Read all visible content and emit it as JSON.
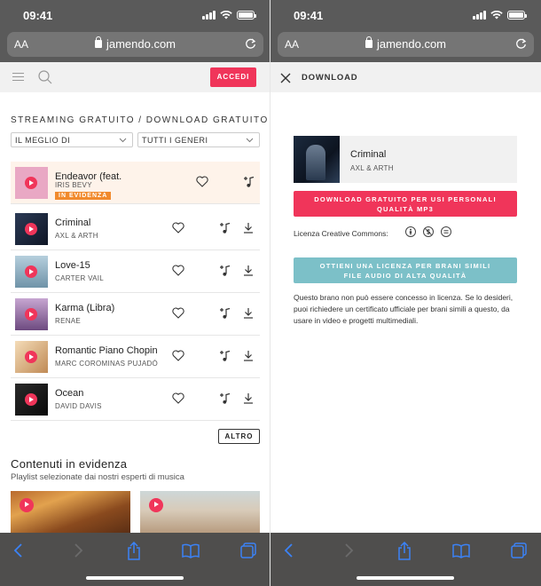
{
  "status_bar": {
    "time": "09:41"
  },
  "browser": {
    "aa_label": "AA",
    "url": "jamendo.com"
  },
  "left": {
    "login_button": "ACCEDI",
    "section_title": "STREAMING GRATUITO / DOWNLOAD GRATUITO",
    "filter_sort": "IL MEGLIO DI",
    "filter_genre": "TUTTI I GENERI",
    "tracks": [
      {
        "title": "Endeavor (feat.",
        "artist": "IRIS BEVY",
        "badge": "IN EVIDENZA",
        "thumb_color": "#e9a8c4"
      },
      {
        "title": "Criminal",
        "artist": "AXL & ARTH",
        "thumb_color": "#2b3a55"
      },
      {
        "title": "Love-15",
        "artist": "CARTER VAIL",
        "thumb_color": "#8fb1c7"
      },
      {
        "title": "Karma (Libra)",
        "artist": "RENAE",
        "thumb_color": "#9c7bb0"
      },
      {
        "title": "Romantic Piano Chopin",
        "artist": "MARC COROMINAS PUJADÓ",
        "thumb_color": "#e8c79b"
      },
      {
        "title": "Ocean",
        "artist": "DAVID DAVIS",
        "thumb_color": "#1a1a1a"
      }
    ],
    "more_button": "ALTRO",
    "featured_title": "Contenuti in evidenza",
    "featured_subtitle": "Playlist selezionate dai nostri esperti di musica"
  },
  "right": {
    "header_title": "DOWNLOAD",
    "track_title": "Criminal",
    "track_artist": "AXL & ARTH",
    "download_button_line1": "DOWNLOAD GRATUITO PER USI PERSONALI",
    "download_button_line2": "QUALITÀ MP3",
    "license_label": "Licenza Creative Commons:",
    "license_button_line1": "OTTIENI UNA LICENZA PER BRANI SIMILI",
    "license_button_line2": "FILE AUDIO DI ALTA QUALITÀ",
    "license_note": "Questo brano non può essere concesso in licenza. Se lo desideri, puoi richiedere un certificato ufficiale per brani simili a questo, da usare in video e progetti multimediali."
  },
  "colors": {
    "accent": "#f0355a",
    "badge": "#f18a2d",
    "license": "#7cc0c8",
    "toolbar": "#4f4e4d",
    "ios_blue": "#3b82f6"
  },
  "icons": [
    "menu-icon",
    "search-icon",
    "heart-icon",
    "add-to-playlist-icon",
    "download-icon",
    "close-icon",
    "back-icon",
    "forward-icon",
    "share-icon",
    "bookmarks-icon",
    "tabs-icon",
    "reload-icon",
    "lock-icon"
  ]
}
